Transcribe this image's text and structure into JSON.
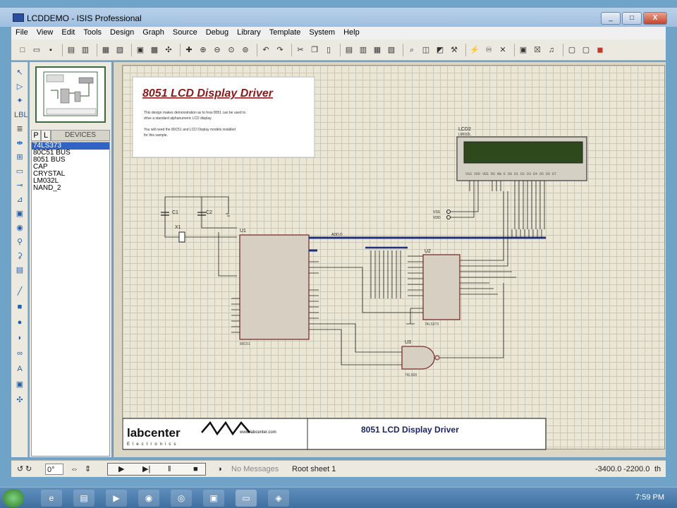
{
  "window": {
    "title": "LCDDEMO - ISIS Professional",
    "buttons": [
      "_",
      "□",
      "X"
    ]
  },
  "menu": [
    "File",
    "View",
    "Edit",
    "Tools",
    "Design",
    "Graph",
    "Source",
    "Debug",
    "Library",
    "Template",
    "System",
    "Help"
  ],
  "devices": {
    "tab_p": "P",
    "tab_l": "L",
    "header": "DEVICES",
    "items": [
      "74LS373",
      "80C51 BUS",
      "8051 BUS",
      "CAP",
      "CRYSTAL",
      "LM032L",
      "NAND_2"
    ],
    "selected_index": 0
  },
  "schematic": {
    "heading": "8051 LCD Display Driver",
    "notes": [
      "This design makes demonstration as to how 8051 can be used to",
      "drive a standard alphanumeric LCD display.",
      "You will need the 80C51 and LCD Display models installed",
      "for this sample."
    ],
    "lcd_label": "LCD2",
    "lcd_part": "LM032L",
    "cap1": "C1",
    "cap2": "C2",
    "crystal": "X1",
    "u1": "U1",
    "u2": "U2",
    "u3": "U3",
    "u1_part": "80C51",
    "u2_part": "74LS373",
    "u3_part": "74LS00",
    "bus_label": "ADD.D",
    "vdd": "VDD",
    "vss": "VSS",
    "title_block": "8051 LCD Display Driver",
    "logo_text": "labcenter",
    "logo_sub": "Electronics",
    "logo_url": "www.labcenter.com"
  },
  "status": {
    "rotation": "0°",
    "messages": "No Messages",
    "sheet": "Root sheet 1",
    "coord_x": "-3400.0",
    "coord_y": "-2200.0",
    "unit": "th"
  },
  "taskbar": {
    "time": "7:59 PM"
  }
}
